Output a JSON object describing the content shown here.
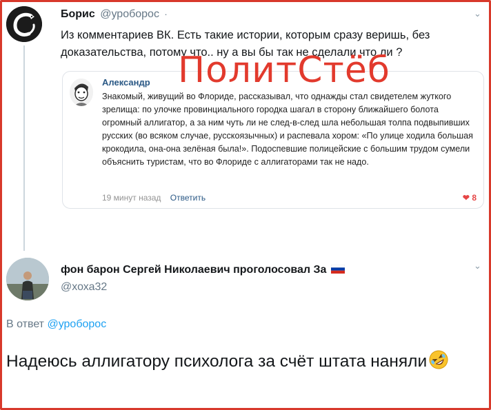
{
  "tweet1": {
    "author": "Борис",
    "handle": "@уроборос",
    "dot": "·",
    "text": "Из комментариев ВК. Есть такие истории, которым сразу веришь, без доказательства, потому что.. ну а вы бы так не сделали что ли ?",
    "avatar_icon": "ouroboros-logo-icon"
  },
  "watermark": "ПолитСтёб",
  "quote": {
    "author": "Александр",
    "text": "Знакомый, живущий во Флориде, рассказывал, что однажды стал свидетелем жуткого зрелища: по улочке провинциального городка шагал в сторону ближайшего болота огромный аллигатор, а за ним чуть ли не след-в-след шла небольшая толпа подвыпивших русских (во всяком случае, русскоязычных) и распевала хором: «По улице ходила большая крокодила, она-она зелёная была!». Подоспевшие полицейские с большим трудом сумели объяснить туристам, что во Флориде с аллигаторами так не надо.",
    "time": "19 минут назад",
    "reply": "Ответить",
    "likes": "8"
  },
  "tweet2": {
    "author": "фон барон Сергей Николаевич проголосовал За",
    "handle": "@хоха32",
    "reply_prefix": "В ответ",
    "reply_handle": "@уроборос",
    "text": "Надеюсь аллигатору психолога за счёт штата наняли"
  },
  "colors": {
    "frame": "#d8392b",
    "watermark": "#e23a2d",
    "link": "#1da1f2",
    "vk_link": "#2a5885"
  }
}
